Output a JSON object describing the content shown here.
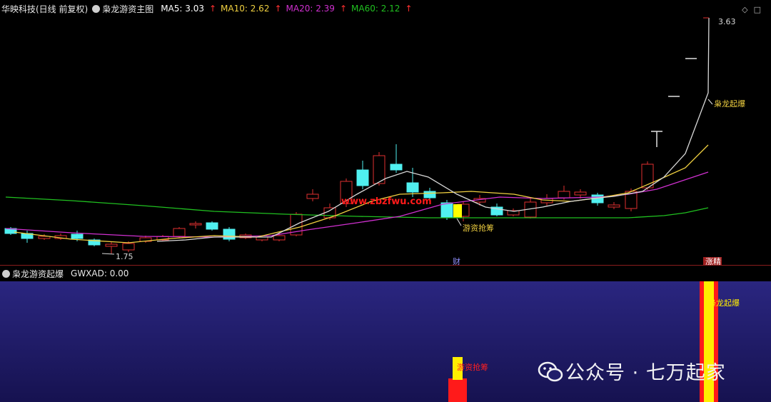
{
  "header": {
    "stock_name": "华映科技(日线 前复权)",
    "formula_icon": "circle-icon",
    "formula_name": "枭龙游资主图",
    "ma": [
      {
        "label": "MA5: 3.03",
        "color": "#ffffff"
      },
      {
        "label": "MA10: 2.62",
        "color": "#f0d040"
      },
      {
        "label": "MA20: 2.39",
        "color": "#d030d0"
      },
      {
        "label": "MA60: 2.12",
        "color": "#20c020"
      }
    ],
    "arrow": "↑",
    "arrow_color": "#ff3030",
    "right_icons": [
      "diamond-icon",
      "square-icon"
    ]
  },
  "main_chart": {
    "price_high_label": "3.63",
    "price_low_label": "1.75",
    "signal_label_1": "游资抢筹",
    "signal_label_2": "枭龙起爆",
    "watermark_site": "www.zbzfwu.com",
    "marker_cai": "财",
    "marker_zhangting": "涨精",
    "colors": {
      "up": "#e03030",
      "down": "#50f0f0",
      "ma5": "#ffffff",
      "ma10": "#f0d040",
      "ma20": "#d030d0",
      "ma60": "#20c020",
      "signal": "#ffff00"
    }
  },
  "indicator": {
    "icon": "circle-icon",
    "name": "枭龙游资起爆",
    "value_label": "GWXAD: 0.00",
    "label_youzi": "游资抢筹",
    "label_qibao": "枭龙起爆",
    "bg_color": "#201e6a"
  },
  "watermark": {
    "icon": "wechat-icon",
    "text": "公众号 · 七万起家"
  }
}
